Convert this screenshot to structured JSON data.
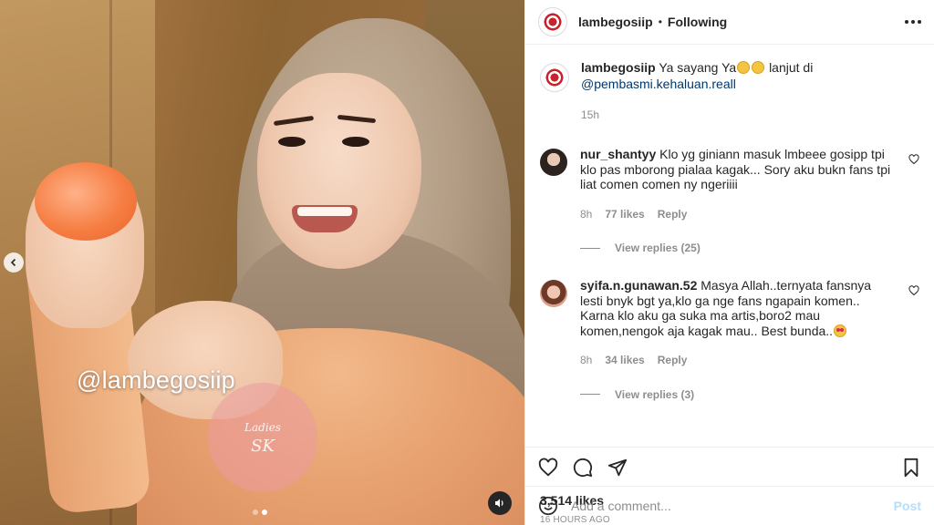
{
  "post": {
    "username": "lambegosiip",
    "following_label": "Following",
    "caption": {
      "username": "lambegosiip",
      "text_before": "Ya sayang Ya",
      "text_after": "lanjut di",
      "emojis": [
        "rolling-on-floor-laughing",
        "rolling-on-floor-laughing"
      ],
      "mention": "@pembasmi.kehaluan.reall",
      "time": "15h"
    },
    "comments": [
      {
        "username": "nur_shantyy",
        "text": "Klo yg giniann masuk lmbeee gosipp tpi klo pas mborong pialaa kagak... Sory aku bukn fans tpi liat comen comen ny ngeriiii",
        "time": "8h",
        "likes": "77 likes",
        "reply_label": "Reply",
        "view_replies": "View replies (25)"
      },
      {
        "username": "syifa.n.gunawan.52",
        "text": "Masya Allah..ternyata fansnya lesti bnyk bgt ya,klo ga nge fans ngapain komen.. Karna klo aku ga suka ma artis,boro2 mau komen,nengok aja kagak mau.. Best bunda..",
        "emoji": "heart-eyes",
        "time": "8h",
        "likes": "34 likes",
        "reply_label": "Reply",
        "view_replies": "View replies (3)"
      }
    ],
    "likes": "3,514 likes",
    "time_ago": "16 HOURS AGO",
    "add_comment_placeholder": "Add a comment...",
    "post_label": "Post"
  },
  "media": {
    "watermark": "@lambegosiip",
    "logo_text": "Ladies SKin",
    "carousel_count": 2,
    "carousel_active": 2
  },
  "colors": {
    "link": "#00376b",
    "muted": "#8e8e8e",
    "post_disabled": "#b2dffc"
  }
}
